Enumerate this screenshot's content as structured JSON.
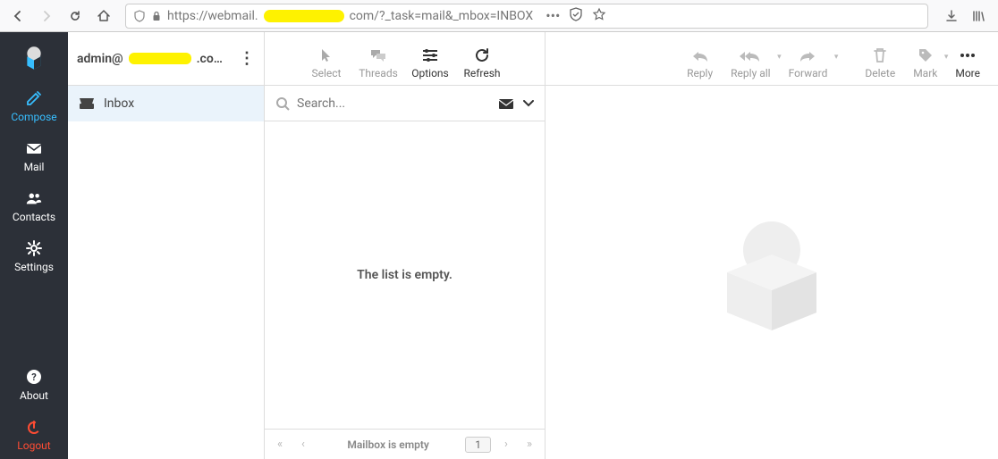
{
  "browser": {
    "url_prefix": "https://webmail.",
    "url_suffix": "com/?_task=mail&_mbox=INBOX"
  },
  "sidebar": {
    "items": [
      {
        "label": "Compose"
      },
      {
        "label": "Mail"
      },
      {
        "label": "Contacts"
      },
      {
        "label": "Settings"
      },
      {
        "label": "About"
      },
      {
        "label": "Logout"
      }
    ]
  },
  "account": {
    "prefix": "admin@",
    "suffix": ".co…"
  },
  "folders": {
    "inbox": "Inbox"
  },
  "toolbar1": {
    "select": "Select",
    "threads": "Threads",
    "options": "Options",
    "refresh": "Refresh"
  },
  "search": {
    "placeholder": "Search..."
  },
  "list": {
    "empty": "The list is empty."
  },
  "pager": {
    "status": "Mailbox is empty",
    "page": "1"
  },
  "toolbar2": {
    "reply": "Reply",
    "reply_all": "Reply all",
    "forward": "Forward",
    "delete": "Delete",
    "mark": "Mark",
    "more": "More"
  }
}
